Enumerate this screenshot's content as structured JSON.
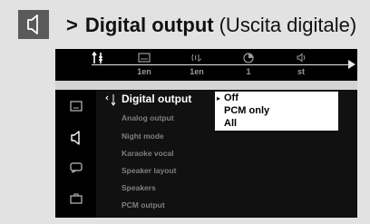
{
  "header": {
    "icon": "speaker-icon",
    "marker": ">",
    "title": "Digital output",
    "subtitle": "(Uscita digitale)"
  },
  "topbar": {
    "selected_icon": "settings-icon",
    "items": [
      {
        "icon": "subtitle-icon",
        "label": "1en"
      },
      {
        "icon": "audio-language-icon",
        "label": "1en"
      },
      {
        "icon": "angle-icon",
        "label": "1"
      },
      {
        "icon": "speaker-icon",
        "label": "st"
      }
    ]
  },
  "sidebar": {
    "icons": [
      "video-setup-icon",
      "audio-setup-icon",
      "language-setup-icon",
      "preferences-icon"
    ]
  },
  "menu": {
    "items": [
      {
        "label": "Digital output",
        "selected": true
      },
      {
        "label": "Analog output"
      },
      {
        "label": "Night mode"
      },
      {
        "label": "Karaoke vocal"
      },
      {
        "label": "Speaker layout"
      },
      {
        "label": "Speakers"
      },
      {
        "label": "PCM output"
      }
    ]
  },
  "submenu": {
    "options": [
      "Off",
      "PCM only",
      "All"
    ],
    "selected": "Off"
  }
}
